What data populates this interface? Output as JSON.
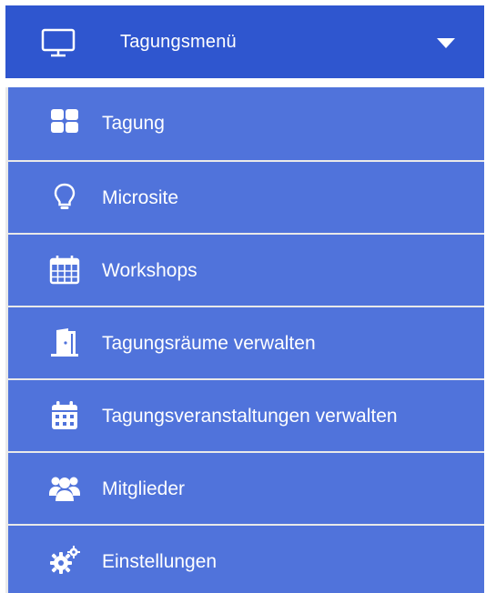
{
  "header": {
    "icon": "monitor-icon",
    "title": "Tagungsmenü",
    "caret_icon": "caret-down-icon"
  },
  "menu": {
    "items": [
      {
        "label": "Tagung",
        "icon": "grid-icon"
      },
      {
        "label": "Microsite",
        "icon": "lightbulb-icon"
      },
      {
        "label": "Workshops",
        "icon": "calendar-grid-icon"
      },
      {
        "label": "Tagungsräume verwalten",
        "icon": "door-icon"
      },
      {
        "label": "Tagungsveranstaltungen verwalten",
        "icon": "calendar-icon"
      },
      {
        "label": "Mitglieder",
        "icon": "users-icon"
      },
      {
        "label": "Einstellungen",
        "icon": "gears-icon"
      }
    ]
  },
  "colors": {
    "header_bg": "#2f56cf",
    "menu_bg": "#5073db",
    "divider": "#e9e9e9",
    "text": "#ffffff"
  }
}
